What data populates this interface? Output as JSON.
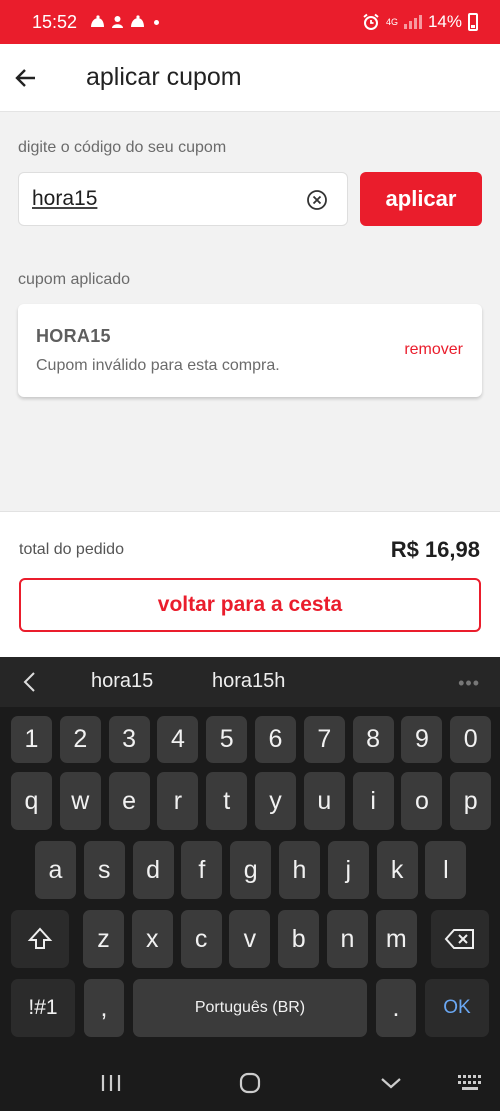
{
  "status_bar": {
    "time": "15:52",
    "network": "4G",
    "battery": "14%",
    "color": "#ea1d2c"
  },
  "header": {
    "title": "aplicar cupom",
    "back_icon": "arrow-left-icon"
  },
  "coupon_form": {
    "label": "digite o código do seu cupom",
    "input_value": "hora15",
    "apply_label": "aplicar"
  },
  "applied": {
    "label": "cupom aplicado",
    "code": "HORA15",
    "message": "Cupom inválido para esta compra.",
    "remove_label": "remover"
  },
  "footer": {
    "total_label": "total do pedido",
    "total_value": "R$ 16,98",
    "back_button_label": "voltar para a cesta"
  },
  "keyboard": {
    "suggestions": [
      "hora15",
      "hora15h"
    ],
    "more": "•••",
    "rows": [
      [
        "1",
        "2",
        "3",
        "4",
        "5",
        "6",
        "7",
        "8",
        "9",
        "0"
      ],
      [
        "q",
        "w",
        "e",
        "r",
        "t",
        "y",
        "u",
        "i",
        "o",
        "p"
      ],
      [
        "a",
        "s",
        "d",
        "f",
        "g",
        "h",
        "j",
        "k",
        "l"
      ],
      [
        "z",
        "x",
        "c",
        "v",
        "b",
        "n",
        "m"
      ]
    ],
    "symbols_key": "!#1",
    "comma_key": ",",
    "space_label": "Português (BR)",
    "period_key": ".",
    "enter_label": "OK"
  },
  "theme": {
    "accent": "#ea1d2c",
    "keyboard_bg": "#1b1b1b",
    "key_bg": "#3b3b3b"
  }
}
